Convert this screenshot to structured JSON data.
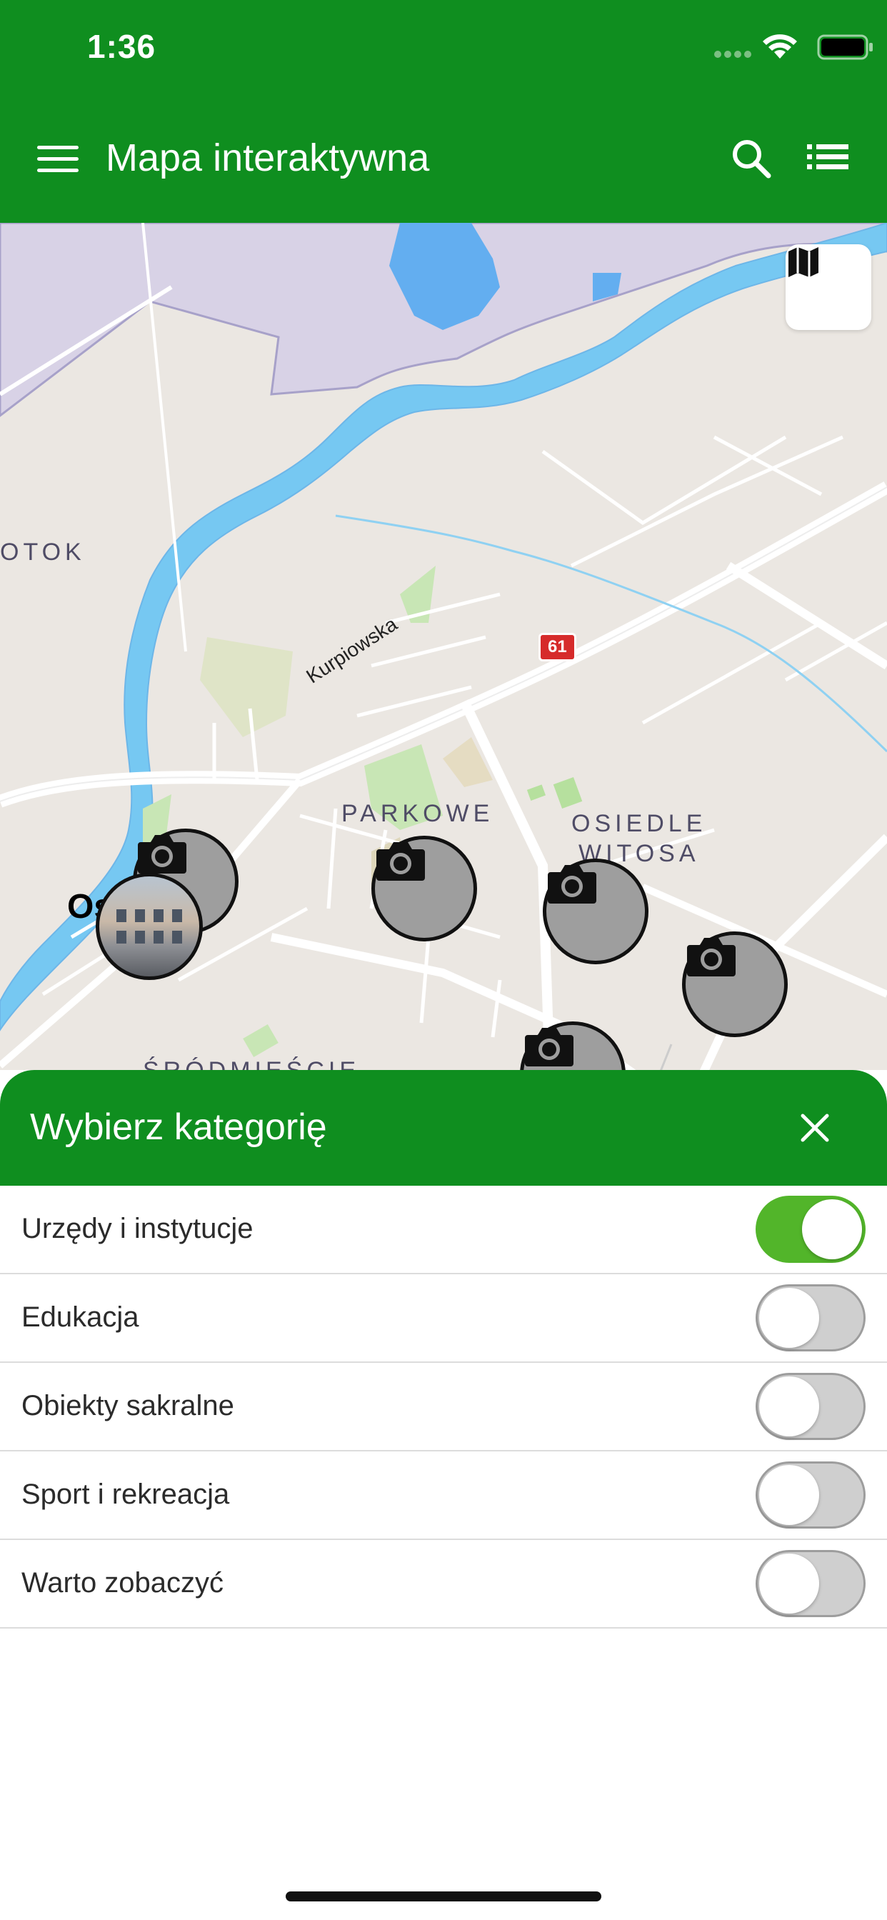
{
  "status_bar": {
    "time": "1:36"
  },
  "header": {
    "title": "Mapa interaktywna"
  },
  "map": {
    "labels": {
      "district_otok": "OTOK",
      "district_parkowe": "PARKOWE",
      "district_osiedle_line1": "OSIEDLE",
      "district_osiedle_line2": "WITOSA",
      "district_srodmiescie": "ŚRÓDMIEŚCIE",
      "street_kurpiowska": "Kurpiowska",
      "road_badge": "61",
      "partial_label": "Os"
    }
  },
  "sheet": {
    "title": "Wybierz kategorię",
    "categories": [
      {
        "label": "Urzędy i instytucje",
        "enabled": true
      },
      {
        "label": "Edukacja",
        "enabled": false
      },
      {
        "label": "Obiekty sakralne",
        "enabled": false
      },
      {
        "label": "Sport i rekreacja",
        "enabled": false
      },
      {
        "label": "Warto zobaczyć",
        "enabled": false
      }
    ]
  },
  "colors": {
    "brand_green": "#0f8e1f",
    "toggle_on": "#52b52a",
    "toggle_off": "#cfcfcf"
  }
}
